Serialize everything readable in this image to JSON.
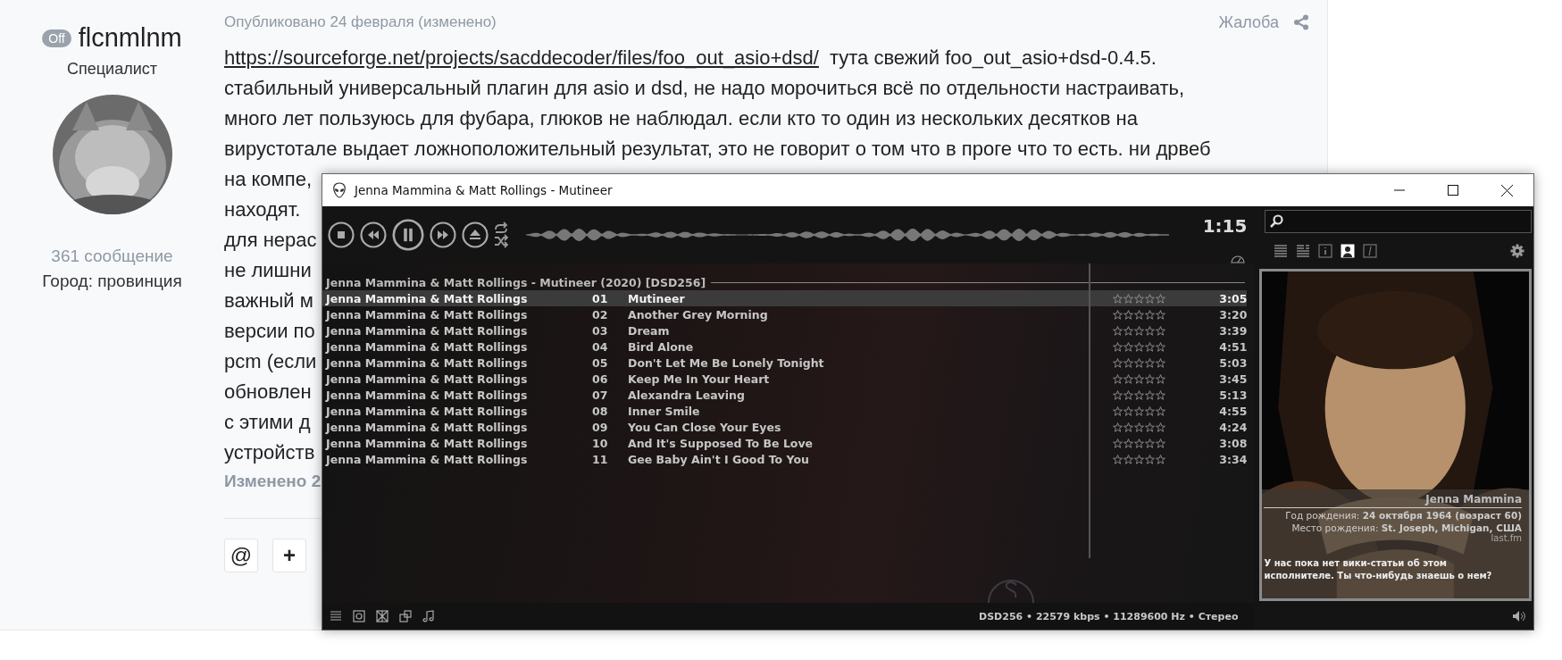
{
  "author": {
    "status": "Off",
    "name": "flcnmlnm",
    "rank": "Специалист",
    "posts": "361 сообщение",
    "city": "Город: провинция"
  },
  "post": {
    "date": "Опубликовано 24 февраля (изменено)",
    "report": "Жалоба",
    "link": "https://sourceforge.net/projects/sacddecoder/files/foo_out_asio+dsd/",
    "link_tail": "тута свежий foo_out_asio+dsd-0.4.5.",
    "lines": [
      "стабильный универсальный плагин для asio и dsd, не надо морочиться всё по отдельности настраивать,",
      "много лет пользуюсь для фубара, глюков не наблюдал. если кто то один из нескольких десятков на",
      "вирустотале выдает ложноположительный результат, это не говорит о том что в проге что то есть. ни дрвеб",
      "на компе,",
      "находят.",
      "для нерас",
      "не лишни",
      "важный м",
      "версии по",
      "pcm (если",
      "обновлен",
      "с этими д",
      "устройств"
    ],
    "edited": "Изменено 2",
    "actions": [
      "@",
      "+"
    ]
  },
  "player": {
    "title": "Jenna Mammina & Matt Rollings - Mutineer",
    "time": "1:15",
    "group": "Jenna Mammina & Matt Rollings - Mutineer (2020) [DSD256]",
    "tracks": [
      {
        "artist": "Jenna Mammina & Matt Rollings",
        "number": "01",
        "title": "Mutineer",
        "stars": 0,
        "duration": "3:05",
        "selected": true
      },
      {
        "artist": "Jenna Mammina & Matt Rollings",
        "number": "02",
        "title": "Another Grey Morning",
        "stars": 0,
        "duration": "3:20",
        "selected": false
      },
      {
        "artist": "Jenna Mammina & Matt Rollings",
        "number": "03",
        "title": "Dream",
        "stars": 0,
        "duration": "3:39",
        "selected": false
      },
      {
        "artist": "Jenna Mammina & Matt Rollings",
        "number": "04",
        "title": "Bird Alone",
        "stars": 0,
        "duration": "4:51",
        "selected": false
      },
      {
        "artist": "Jenna Mammina & Matt Rollings",
        "number": "05",
        "title": "Don't Let Me Be Lonely Tonight",
        "stars": 0,
        "duration": "5:03",
        "selected": false
      },
      {
        "artist": "Jenna Mammina & Matt Rollings",
        "number": "06",
        "title": "Keep Me In Your Heart",
        "stars": 0,
        "duration": "3:45",
        "selected": false
      },
      {
        "artist": "Jenna Mammina & Matt Rollings",
        "number": "07",
        "title": "Alexandra Leaving",
        "stars": 0,
        "duration": "5:13",
        "selected": false
      },
      {
        "artist": "Jenna Mammina & Matt Rollings",
        "number": "08",
        "title": "Inner Smile",
        "stars": 0,
        "duration": "4:55",
        "selected": false
      },
      {
        "artist": "Jenna Mammina & Matt Rollings",
        "number": "09",
        "title": "You Can Close Your Eyes",
        "stars": 0,
        "duration": "4:24",
        "selected": false
      },
      {
        "artist": "Jenna Mammina & Matt Rollings",
        "number": "10",
        "title": "And It's Supposed To Be Love",
        "stars": 0,
        "duration": "3:08",
        "selected": false
      },
      {
        "artist": "Jenna Mammina & Matt Rollings",
        "number": "11",
        "title": "Gee Baby Ain't I Good To You",
        "stars": 0,
        "duration": "3:34",
        "selected": false
      }
    ],
    "status": "DSD256 • 22579 kbps • 11289600 Hz • Стерео",
    "panel_tabs": [
      {
        "selected": false
      },
      {
        "selected": false
      },
      {
        "selected": false
      },
      {
        "selected": true
      },
      {
        "selected": false
      }
    ],
    "artist": {
      "name": "Jenna Mammina",
      "birth": "Год рождения: **24 октября 1964 (возраст 60)**",
      "place": "Место рождения: **St. Joseph, Michigan, США**",
      "source": "last.fm",
      "bio": "У нас пока нет вики-статьи об этом исполнителе. Ты что-нибудь знаешь о нем?"
    }
  }
}
